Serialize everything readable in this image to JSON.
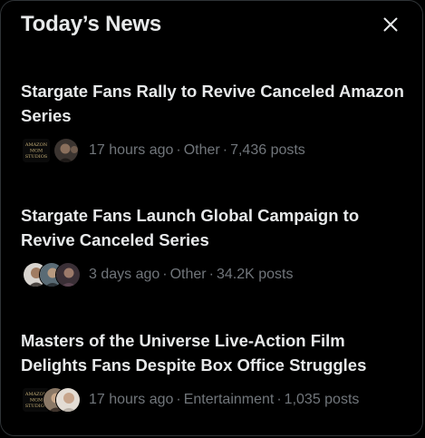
{
  "panel": {
    "title": "Today’s News",
    "close_icon": "close-icon"
  },
  "stories": [
    {
      "headline": "Stargate Fans Rally to Revive Canceled Amazon Series",
      "time": "17 hours ago",
      "category": "Other",
      "posts": "7,436 posts",
      "avatars": [
        "amazon-mgm-studios-logo",
        "person-avatar"
      ],
      "logo_text": [
        "AMAZON",
        "MGM",
        "STUDIOS"
      ]
    },
    {
      "headline": "Stargate Fans Launch Global Campaign to Revive Canceled Series",
      "time": "3 days ago",
      "category": "Other",
      "posts": "34.2K posts",
      "avatars": [
        "person-avatar",
        "person-avatar",
        "person-avatar"
      ]
    },
    {
      "headline": "Masters of the Universe Live-Action Film Delights Fans Despite Box Office Struggles",
      "time": "17 hours ago",
      "category": "Entertainment",
      "posts": "1,035 posts",
      "avatars": [
        "amazon-mgm-studios-logo",
        "person-avatar",
        "person-avatar"
      ],
      "logo_text": [
        "AMAZON",
        "MGM",
        "STUDIOS"
      ]
    }
  ],
  "separator": "·"
}
